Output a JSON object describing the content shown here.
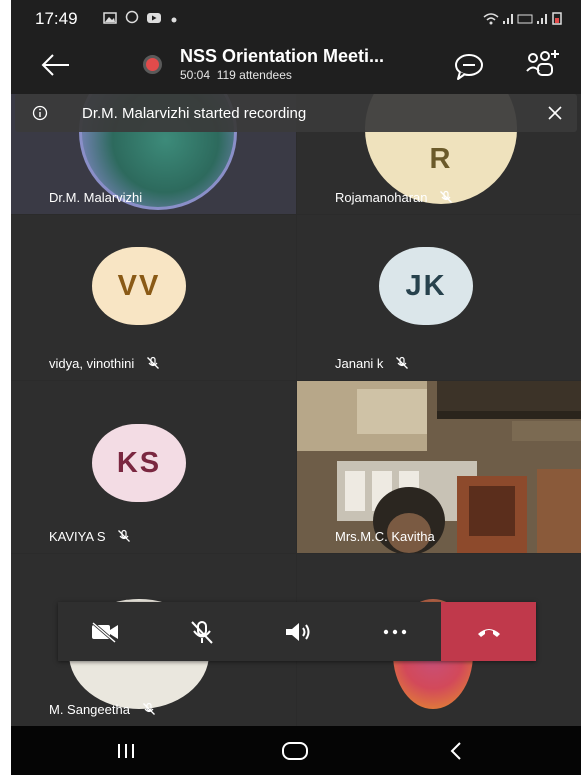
{
  "status_bar": {
    "time": "17:49",
    "icons": [
      "image-icon",
      "whatsapp-icon",
      "youtube-icon",
      "dot-icon"
    ],
    "system_icons": [
      "wifi-icon",
      "signal-icon",
      "volte-icon",
      "battery-icon"
    ]
  },
  "header": {
    "title": "NSS Orientation Meeti...",
    "duration": "50:04",
    "attendees": "119 attendees"
  },
  "banner": {
    "message": "Dr.M. Malarvizhi started recording"
  },
  "participants": [
    {
      "name": "Dr.M. Malarvizhi",
      "muted": false
    },
    {
      "name": "Rojamanoharan",
      "initials": "R",
      "muted": true
    },
    {
      "name": "vidya, vinothini",
      "initials": "VV",
      "muted": true
    },
    {
      "name": "Janani k",
      "initials": "JK",
      "muted": true
    },
    {
      "name": "KAVIYA S",
      "initials": "KS",
      "muted": true
    },
    {
      "name": "Mrs.M.C. Kavitha",
      "muted": false
    },
    {
      "name": "M. Sangeetha",
      "muted": true
    },
    {
      "name": "",
      "muted": false
    }
  ],
  "colors": {
    "recording_dot": "#e24b4b",
    "hangup": "#c0394b",
    "avatar_vv": "#f8e5c4",
    "avatar_jk": "#dbe6ea",
    "avatar_ks": "#f3dce4",
    "avatar_r": "#efe2bd"
  },
  "controls": [
    "camera-off-icon",
    "mic-off-icon",
    "speaker-icon",
    "more-icon",
    "hang-up-icon"
  ],
  "nav_bar": [
    "recents-icon",
    "home-icon",
    "back-nav-icon"
  ]
}
